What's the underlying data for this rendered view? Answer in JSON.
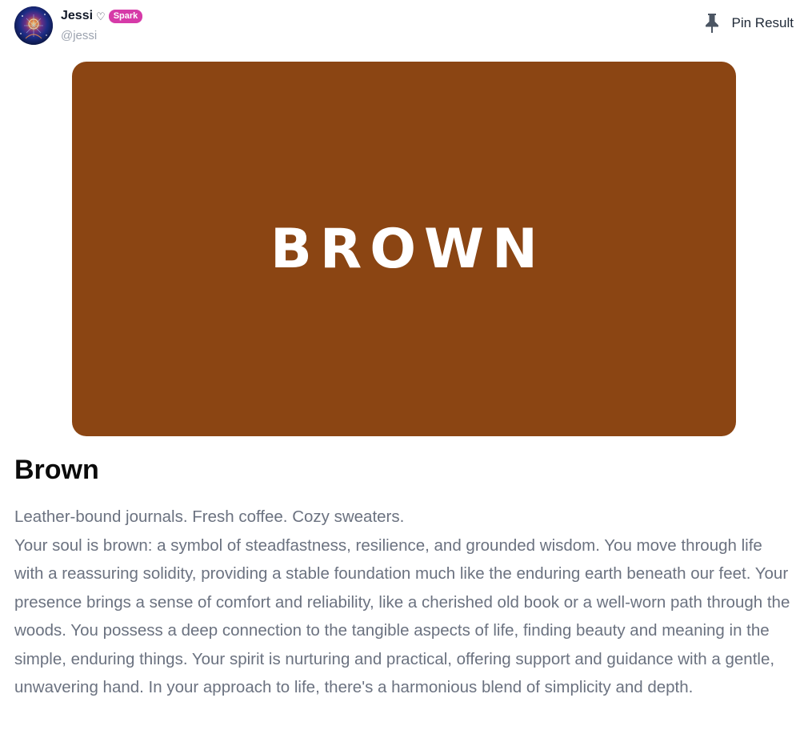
{
  "user": {
    "name": "Jessi",
    "heart": "♡",
    "badge": "Spark",
    "handle": "@jessi"
  },
  "actions": {
    "pin_label": "Pin Result",
    "pin_icon": "pushpin-icon"
  },
  "card": {
    "word": "BROWN",
    "color": "#8b4513",
    "text_color": "#ffffff"
  },
  "result": {
    "title": "Brown",
    "tagline": "Leather-bound journals. Fresh coffee. Cozy sweaters.",
    "description": "Your soul is brown: a symbol of steadfastness, resilience, and grounded wisdom. You move through life with a reassuring solidity, providing a stable foundation much like the enduring earth beneath our feet. Your presence brings a sense of comfort and reliability, like a cherished old book or a well-worn path through the woods. You possess a deep connection to the tangible aspects of life, finding beauty and meaning in the simple, enduring things. Your spirit is nurturing and practical, offering support and guidance with a gentle, unwavering hand. In your approach to life, there's a harmonious blend of simplicity and depth."
  },
  "colors": {
    "badge": "#d63aa8",
    "body_text": "#6b7280",
    "handle_text": "#9ca3af"
  }
}
